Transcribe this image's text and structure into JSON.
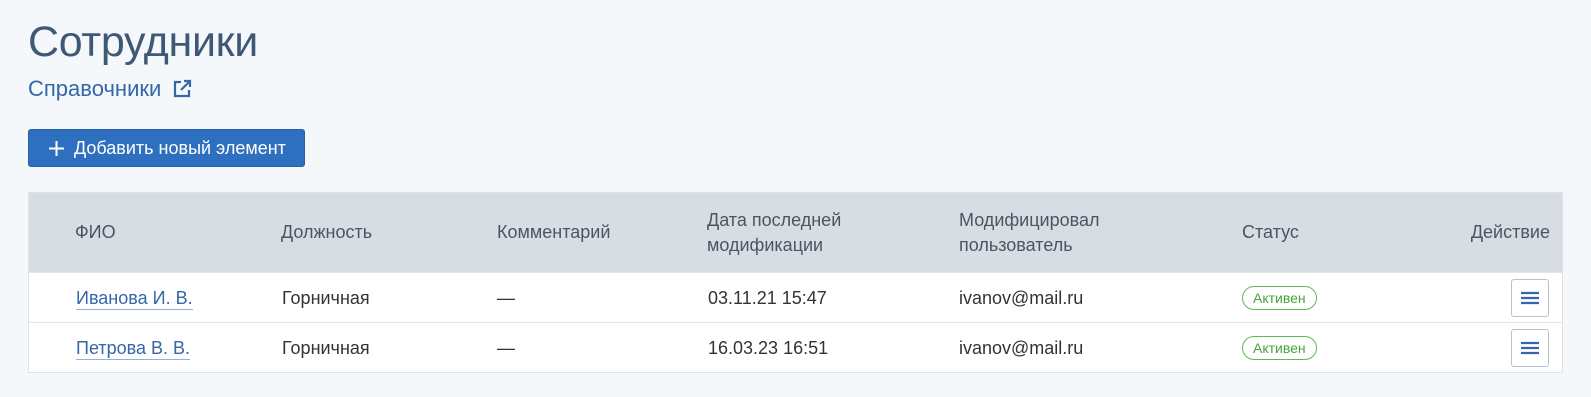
{
  "page": {
    "title": "Сотрудники",
    "breadcrumb_label": "Справочники",
    "breadcrumb_icon": "external-link-icon",
    "add_button_label": "Добавить новый элемент",
    "add_button_icon": "plus-icon"
  },
  "table": {
    "headers": {
      "name": "ФИО",
      "position": "Должность",
      "comment": "Комментарий",
      "date_line1": "Дата последней",
      "date_line2": "модификации",
      "modifier_line1": "Модифицировал",
      "modifier_line2": "пользователь",
      "status": "Статус",
      "action": "Действие"
    },
    "rows": [
      {
        "name": "Иванова И. В.",
        "position": "Горничная",
        "comment": "—",
        "date": "03.11.21 15:47",
        "modifier": "ivanov@mail.ru",
        "status": "Активен",
        "action_icon": "menu-icon"
      },
      {
        "name": "Петрова В. В.",
        "position": "Горничная",
        "comment": "—",
        "date": "16.03.23 16:51",
        "modifier": "ivanov@mail.ru",
        "status": "Активен",
        "action_icon": "menu-icon"
      }
    ]
  },
  "colors": {
    "background": "#f5f8fb",
    "title": "#3e5875",
    "link": "#3566a8",
    "primary_button": "#2f6fbf",
    "table_header": "#d8dde3",
    "status_active": "#45a23d"
  }
}
